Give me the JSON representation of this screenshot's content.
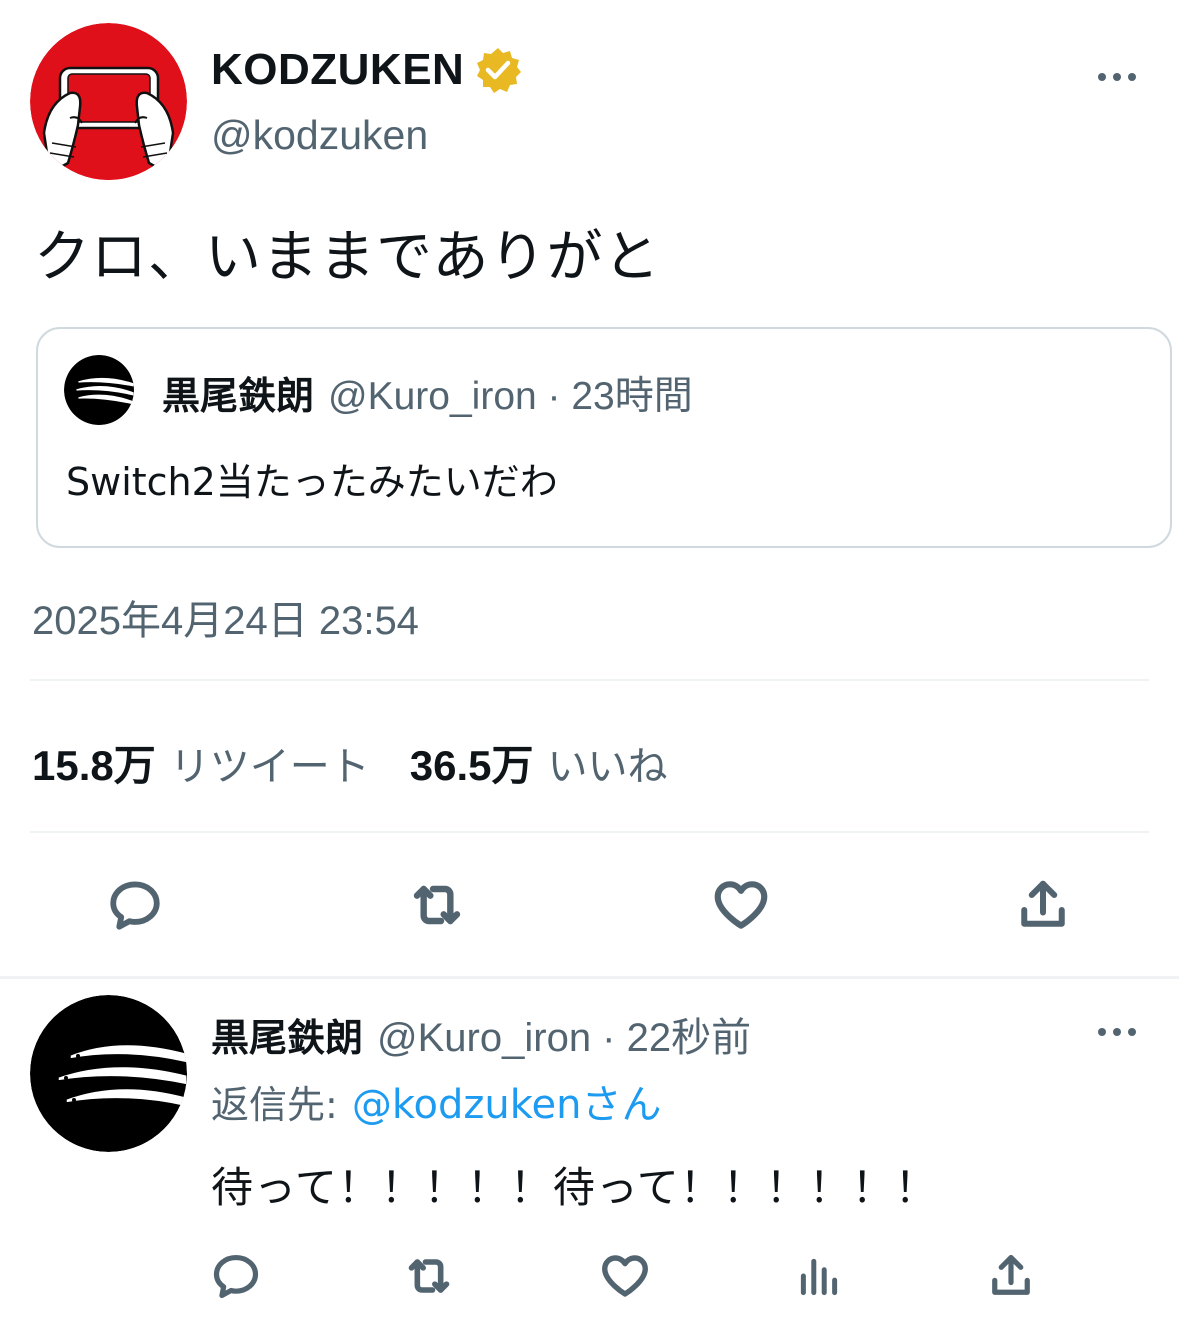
{
  "main_tweet": {
    "author_name": "KODZUKEN",
    "handle": "@kodzuken",
    "avatar_icon": "hands-holding-game-console-icon",
    "verified_icon": "verified-badge-icon",
    "text": "クロ、いままでありがと",
    "timestamp": "2025年4月24日 23:54",
    "stats": {
      "retweets_count": "15.8万",
      "retweets_label": "リツイート",
      "likes_count": "36.5万",
      "likes_label": "いいね"
    }
  },
  "quoted_tweet": {
    "author_name": "黒尾鉄朗",
    "meta": "@Kuro_iron · 23時間",
    "avatar_icon": "saury-fish-icon",
    "text": "Switch2当たったみたいだわ"
  },
  "reply_tweet": {
    "author_name": "黒尾鉄朗",
    "meta": "@Kuro_iron · 22秒前",
    "avatar_icon": "saury-fish-icon",
    "replying_label": "返信先:",
    "replying_handle": "@kodzukenさん",
    "text": "待って！！！！！待って！！！！！！"
  },
  "colors": {
    "text_primary": "#0f1419",
    "text_secondary": "#536471",
    "link": "#1d9bf0",
    "divider": "#eff3f4",
    "verified_gold": "#e8b923",
    "avatar_red": "#e0101b"
  }
}
